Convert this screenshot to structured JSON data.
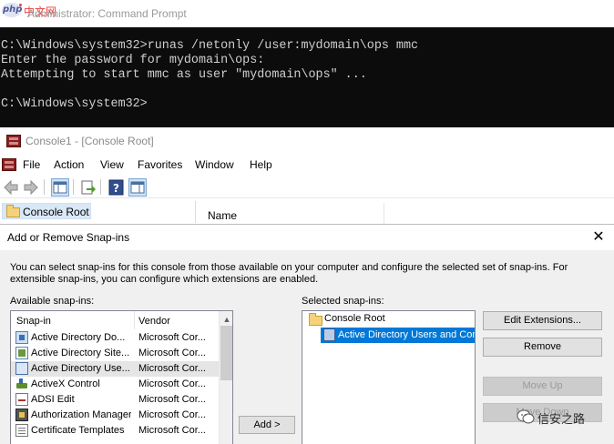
{
  "cmd": {
    "title": "Administrator: Command Prompt",
    "logo_text": "php",
    "logo_cn": "中文网",
    "lines": [
      "C:\\Windows\\system32>runas /netonly /user:mydomain\\ops mmc",
      "Enter the password for mydomain\\ops:",
      "Attempting to start mmc as user \"mydomain\\ops\" ...",
      "",
      "C:\\Windows\\system32>"
    ]
  },
  "mmc": {
    "title": "Console1 - [Console Root]",
    "menu": [
      "File",
      "Action",
      "View",
      "Favorites",
      "Window",
      "Help"
    ],
    "tree_root": "Console Root",
    "list_column": "Name"
  },
  "dialog": {
    "title": "Add or Remove Snap-ins",
    "close_glyph": "✕",
    "description": "You can select snap-ins for this console from those available on your computer and configure the selected set of snap-ins. For extensible snap-ins, you can configure which extensions are enabled.",
    "available_label": "Available snap-ins:",
    "selected_label": "Selected snap-ins:",
    "col_snapin": "Snap-in",
    "col_vendor": "Vendor",
    "snapins": [
      {
        "name": "Active Directory Do...",
        "vendor": "Microsoft Cor...",
        "icon": "ad-domains-icon"
      },
      {
        "name": "Active Directory Site...",
        "vendor": "Microsoft Cor...",
        "icon": "ad-sites-icon"
      },
      {
        "name": "Active Directory Use...",
        "vendor": "Microsoft Cor...",
        "icon": "ad-users-icon"
      },
      {
        "name": "ActiveX Control",
        "vendor": "Microsoft Cor...",
        "icon": "activex-icon"
      },
      {
        "name": "ADSI Edit",
        "vendor": "Microsoft Cor...",
        "icon": "adsi-edit-icon"
      },
      {
        "name": "Authorization Manager",
        "vendor": "Microsoft Cor...",
        "icon": "authorization-manager-icon"
      },
      {
        "name": "Certificate Templates",
        "vendor": "Microsoft Cor...",
        "icon": "certificate-templates-icon"
      }
    ],
    "add_button": "Add >",
    "selected_root": "Console Root",
    "selected_child": "Active Directory Users and Comp",
    "buttons": {
      "edit_extensions": "Edit Extensions...",
      "remove": "Remove",
      "move_up": "Move Up",
      "move_down": "Move Down"
    }
  },
  "watermark": {
    "text": "信安之路"
  }
}
